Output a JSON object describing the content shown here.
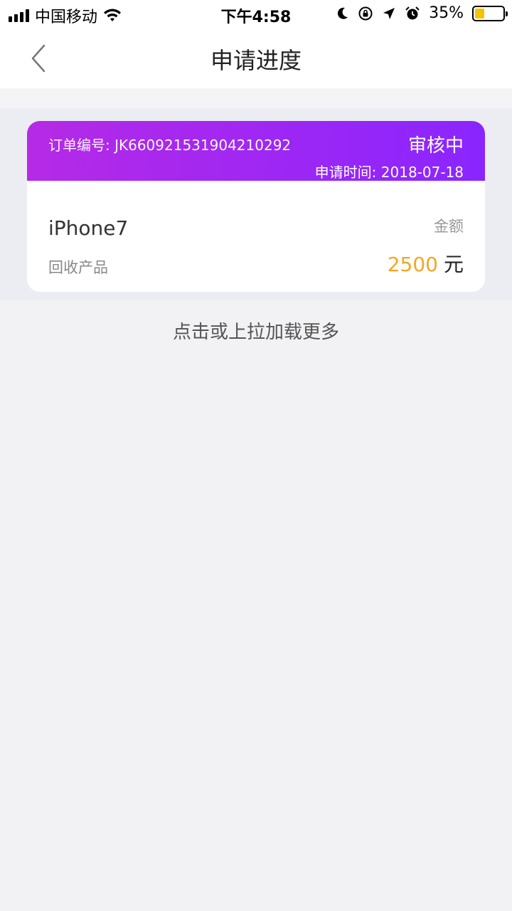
{
  "status_bar": {
    "carrier": "中国移动",
    "time": "下午4:58",
    "battery_percent": "35%",
    "battery_level": 0.35,
    "battery_color": "#f5c400"
  },
  "nav": {
    "title": "申请进度",
    "back_icon": "chevron-left-icon"
  },
  "order": {
    "order_no": "订单编号: JK660921531904210292",
    "status": "审核中",
    "apply_time": "申请时间: 2018-07-18",
    "product_name": "iPhone7",
    "product_label": "回收产品",
    "amount_label": "金额",
    "amount_value": "2500",
    "amount_unit": "元",
    "header_gradient": [
      "#b52ae6",
      "#8a25ff"
    ],
    "amount_color": "#f5a623"
  },
  "load_more": "点击或上拉加载更多"
}
